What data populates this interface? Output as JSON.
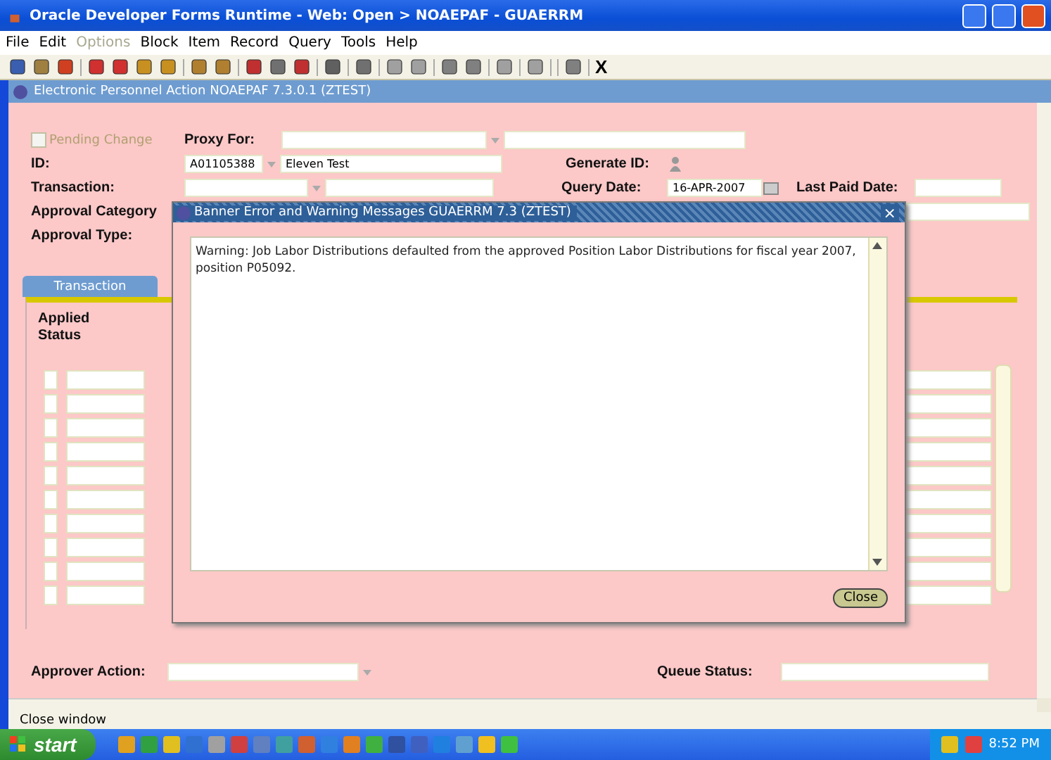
{
  "window": {
    "title": "Oracle Developer Forms Runtime - Web:  Open > NOAEPAF - GUAERRM"
  },
  "menu": [
    {
      "label": "File",
      "disabled": false
    },
    {
      "label": "Edit",
      "disabled": false
    },
    {
      "label": "Options",
      "disabled": true
    },
    {
      "label": "Block",
      "disabled": false
    },
    {
      "label": "Item",
      "disabled": false
    },
    {
      "label": "Record",
      "disabled": false
    },
    {
      "label": "Query",
      "disabled": false
    },
    {
      "label": "Tools",
      "disabled": false
    },
    {
      "label": "Help",
      "disabled": false
    }
  ],
  "toolbar": {
    "exit_glyph": "X"
  },
  "form": {
    "title": "Electronic Personnel Action  NOAEPAF  7.3.0.1  (ZTEST)",
    "pending_change": {
      "label": "Pending Change",
      "checked": false,
      "disabled": true
    },
    "proxy_for": {
      "label": "Proxy For:"
    },
    "id": {
      "label": "ID:",
      "value": "A01105388",
      "name": "Eleven Test"
    },
    "generate_id": {
      "label": "Generate ID:"
    },
    "transaction": {
      "label": "Transaction:"
    },
    "query_date": {
      "label": "Query Date:",
      "value": "16-APR-2007"
    },
    "last_paid_date": {
      "label": "Last Paid Date:"
    },
    "approval_category": {
      "label": "Approval Category"
    },
    "approval_type": {
      "label": "Approval Type:"
    },
    "tabs": [
      {
        "label": "Transaction",
        "selected": true
      }
    ],
    "applied_status": {
      "label": "Applied Status"
    },
    "approver_action": {
      "label": "Approver Action:"
    },
    "queue_status": {
      "label": "Queue Status:"
    }
  },
  "dialog": {
    "title": "Banner Error and Warning Messages  GUAERRM  7.3  (ZTEST)",
    "close_glyph": "×",
    "message": "Warning: Job Labor Distributions defaulted from the approved Position Labor Distributions for fiscal year 2007, position P05092.",
    "button": "Close"
  },
  "status_bar": {
    "text": "Close window"
  },
  "taskbar": {
    "start": "start",
    "clock": "8:52 PM"
  }
}
